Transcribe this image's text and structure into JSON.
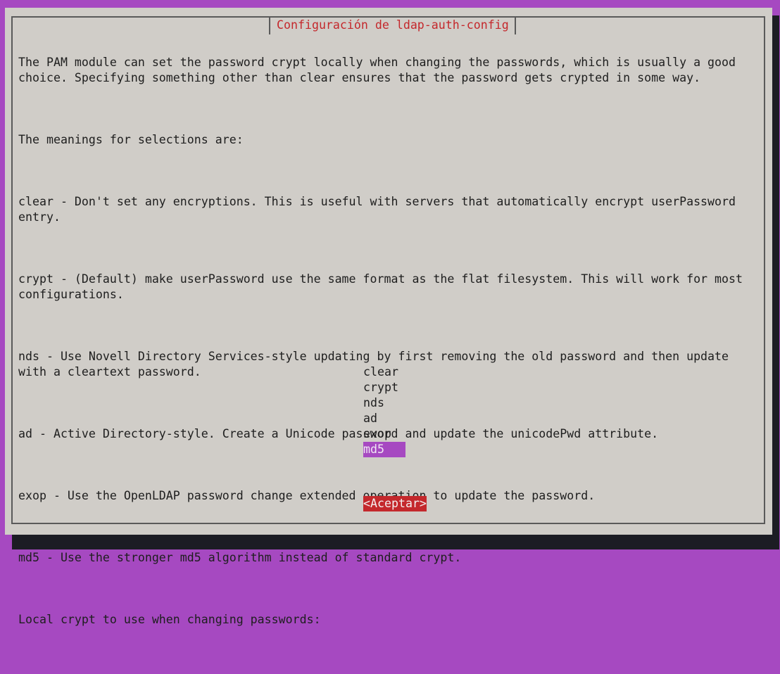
{
  "dialog": {
    "title": "Configuración de ldap-auth-config",
    "paragraphs": [
      "The PAM module can set the password crypt locally when changing the passwords, which is usually a good\nchoice. Specifying something other than clear ensures that the password gets crypted in some way.",
      "The meanings for selections are:",
      "clear - Don't set any encryptions. This is useful with servers that automatically encrypt userPassword\nentry.",
      "crypt - (Default) make userPassword use the same format as the flat filesystem. This will work for most\nconfigurations.",
      "nds - Use Novell Directory Services-style updating by first removing the old password and then update\nwith a cleartext password.",
      "ad - Active Directory-style. Create a Unicode password and update the unicodePwd attribute.",
      "exop - Use the OpenLDAP password change extended operation to update the password.",
      "md5 - Use the stronger md5 algorithm instead of standard crypt.",
      "Local crypt to use when changing passwords:"
    ],
    "options": [
      {
        "label": "clear",
        "selected": false
      },
      {
        "label": "crypt",
        "selected": false
      },
      {
        "label": "nds",
        "selected": false
      },
      {
        "label": "ad",
        "selected": false
      },
      {
        "label": "exop",
        "selected": false
      },
      {
        "label": "md5",
        "selected": true
      }
    ],
    "ok_label": "<Aceptar>"
  },
  "colors": {
    "terminal_background": "#a649c1",
    "dialog_background": "#d0cdc8",
    "title_text": "#c4282c",
    "selection_highlight": "#a649c1",
    "button_background": "#c4282c"
  }
}
